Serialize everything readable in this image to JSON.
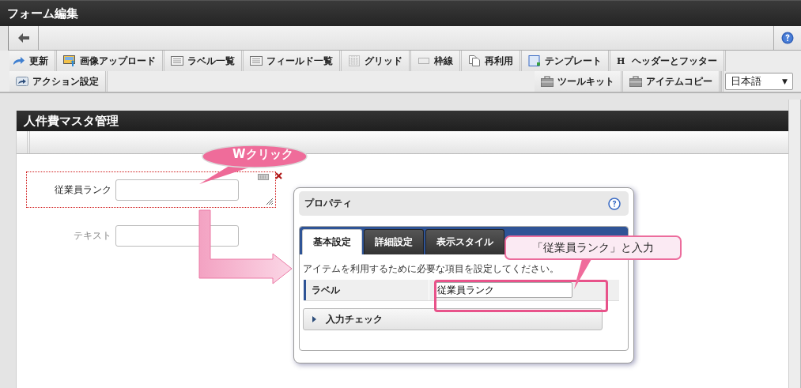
{
  "window": {
    "title": "フォーム編集"
  },
  "toolbar_row_1": [
    {
      "label": "更新"
    },
    {
      "label": "画像アップロード"
    },
    {
      "label": "ラベル一覧"
    },
    {
      "label": "フィールド一覧"
    },
    {
      "label": "グリッド"
    },
    {
      "label": "枠線"
    },
    {
      "label": "再利用"
    },
    {
      "label": "テンプレート"
    },
    {
      "label": "ヘッダーとフッター",
      "glyph": "H"
    }
  ],
  "toolbar_row_2_left": [
    {
      "label": "アクション設定"
    }
  ],
  "toolbar_row_2_right": [
    {
      "label": "ツールキット"
    },
    {
      "label": "アイテムコピー"
    }
  ],
  "language_select": {
    "value": "日本語",
    "arrow": "▼"
  },
  "form": {
    "title": "人件費マスタ管理",
    "fields": [
      {
        "label": "従業員ランク",
        "selected": true
      },
      {
        "label": "テキスト",
        "selected": false
      }
    ]
  },
  "callouts": [
    {
      "kind": "bubble",
      "text": "Wクリック"
    },
    {
      "kind": "box",
      "text": "「従業員ランク」と入力"
    }
  ],
  "properties_dialog": {
    "title": "プロパティ",
    "tabs": [
      {
        "label": "基本設定",
        "selected": true
      },
      {
        "label": "詳細設定",
        "selected": false
      },
      {
        "label": "表示スタイル",
        "selected": false
      }
    ],
    "description": "アイテムを利用するために必要な項目を設定してください。",
    "rows": [
      {
        "label": "ラベル",
        "value": "従業員ランク"
      }
    ],
    "sections": [
      {
        "label": "入力チェック",
        "expanded": false
      }
    ]
  }
}
